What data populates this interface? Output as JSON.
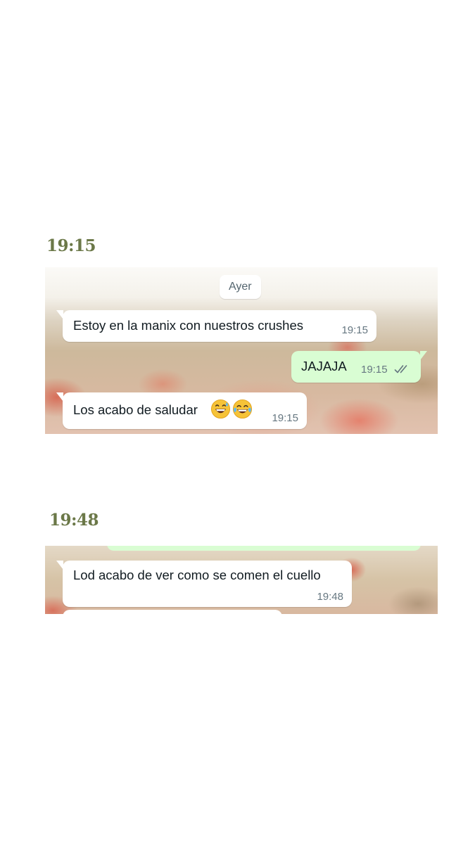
{
  "sections": [
    {
      "heading": "19:15",
      "date_chip": "Ayer",
      "messages": [
        {
          "direction": "incoming",
          "text": "Estoy en la manix con nuestros crushes",
          "time": "19:15"
        },
        {
          "direction": "outgoing",
          "text": "JAJAJA",
          "time": "19:15",
          "status_icon": "double-check-icon"
        },
        {
          "direction": "incoming",
          "text": "Los acabo de saludar",
          "emojis": [
            "grinning-sweat-emoji",
            "tears-of-joy-emoji"
          ],
          "time": "19:15"
        }
      ]
    },
    {
      "heading": "19:48",
      "messages": [
        {
          "direction": "incoming",
          "text": "Lod acabo de ver como se comen el cuello",
          "time": "19:48"
        }
      ]
    }
  ],
  "colors": {
    "heading": "#6b7848",
    "incoming_bubble": "#ffffff",
    "outgoing_bubble": "#d9fdd3",
    "timestamp": "#667781",
    "message_text": "#111b21"
  }
}
